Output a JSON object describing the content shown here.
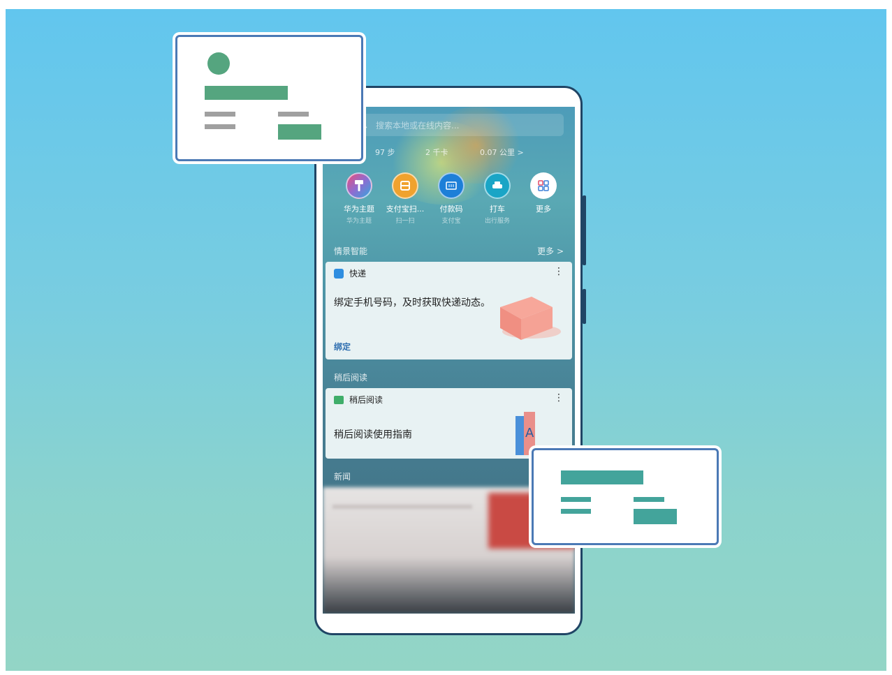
{
  "search": {
    "placeholder": "搜索本地或在线内容..."
  },
  "stats": {
    "steps": "97 步",
    "calories": "2 千卡",
    "distance": "0.07 公里 >"
  },
  "apps": [
    {
      "name": "华为主题",
      "sub": "华为主题",
      "color": "#8e6cd1",
      "icon": "brush-icon"
    },
    {
      "name": "支付宝扫...",
      "sub": "扫一扫",
      "color": "#f0a22e",
      "icon": "scan-icon"
    },
    {
      "name": "付款码",
      "sub": "支付宝",
      "color": "#1d7fd8",
      "icon": "barcode-icon"
    },
    {
      "name": "打车",
      "sub": "出行服务",
      "color": "#1aa5c6",
      "icon": "taxi-icon"
    },
    {
      "name": "更多",
      "sub": "",
      "color": "#ffffff",
      "icon": "grid-icon"
    }
  ],
  "section_smart": {
    "title": "情景智能",
    "more": "更多 >"
  },
  "express_card": {
    "title": "快递",
    "body": "绑定手机号码，及时获取快递动态。",
    "action": "绑定"
  },
  "section_later": {
    "title": "稍后阅读"
  },
  "later_card": {
    "title": "稍后阅读",
    "body": "稍后阅读使用指南"
  },
  "section_news": {
    "title": "新闻"
  },
  "colors": {
    "green": "#55a57f",
    "teal": "#43a49b",
    "border": "#4b79b5",
    "gray": "#a0a0a0"
  }
}
